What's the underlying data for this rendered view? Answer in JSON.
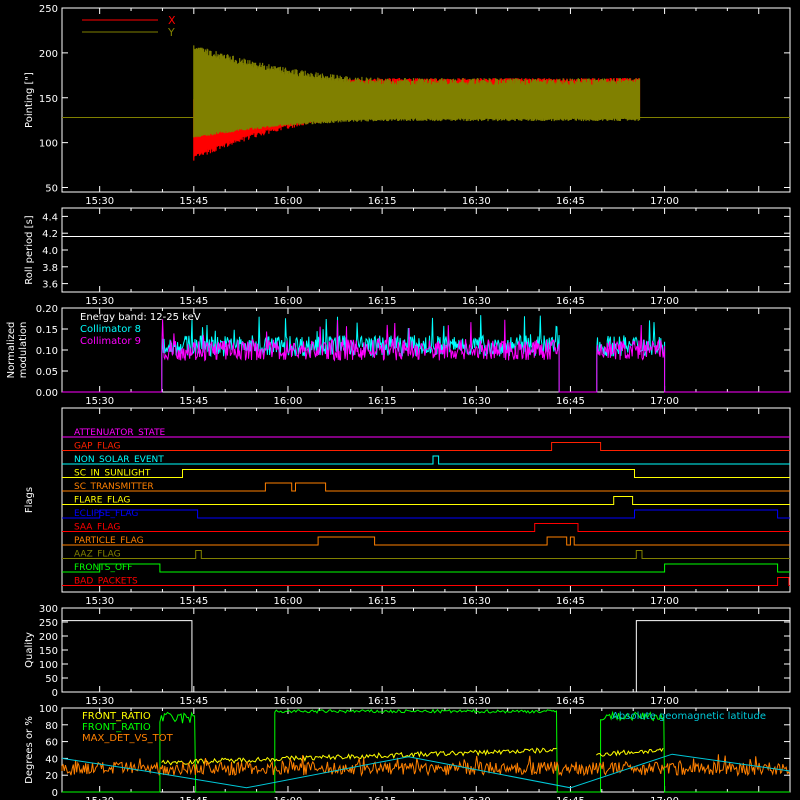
{
  "chart_data": [
    {
      "type": "line",
      "panel": "pointing",
      "ylabel": "Pointing [\"]",
      "ylim": [
        45,
        250
      ],
      "yticks": [
        "50",
        "100",
        "150",
        "200",
        "250"
      ],
      "x_ticks": [
        "15:30",
        "15:45",
        "16:00",
        "16:15",
        "16:30",
        "16:45",
        "17:00"
      ],
      "flat_value": 128,
      "oscillation_start": "15:45",
      "oscillation_end": "16:56",
      "series": [
        {
          "name": "X",
          "color": "#ff0000",
          "envelope_low_start": 80,
          "envelope_low_end": 130,
          "envelope_high_start": 152,
          "envelope_high_end": 172
        },
        {
          "name": "Y",
          "color": "#808000",
          "envelope_low_start": 105,
          "envelope_low_end": 124,
          "envelope_high_start": 210,
          "envelope_high_end": 172
        }
      ]
    },
    {
      "type": "line",
      "panel": "roll",
      "ylabel": "Roll period [s]",
      "ylim": [
        3.5,
        4.5
      ],
      "yticks": [
        "3.6",
        "3.8",
        "4.0",
        "4.2",
        "4.4"
      ],
      "x_ticks": [
        "15:30",
        "15:45",
        "16:00",
        "16:15",
        "16:30",
        "16:45",
        "17:00"
      ],
      "series": [
        {
          "name": "",
          "color": "#ffffff",
          "value": 4.16
        }
      ]
    },
    {
      "type": "line",
      "panel": "modulation",
      "ylabel": "Normalized modulation",
      "ylim": [
        0,
        0.2
      ],
      "yticks": [
        "0.00",
        "0.05",
        "0.10",
        "0.15",
        "0.20"
      ],
      "x_ticks": [
        "15:30",
        "15:45",
        "16:00",
        "16:15",
        "16:30",
        "16:45",
        "17:00"
      ],
      "annotation": "Energy band: 12-25 keV",
      "series": [
        {
          "name": "Collimator 8",
          "color": "#00ffff",
          "mean": 0.11
        },
        {
          "name": "Collimator 9",
          "color": "#ff00ff",
          "mean": 0.1
        }
      ]
    },
    {
      "type": "line",
      "panel": "flags",
      "ylabel": "Flags",
      "x_ticks": [
        "15:30",
        "15:45",
        "16:00",
        "16:15",
        "16:30",
        "16:45",
        "17:00"
      ],
      "series": [
        {
          "name": "ATTENUATOR_STATE",
          "color": "#ff00ff",
          "segments": []
        },
        {
          "name": "GAP_FLAG",
          "color": "#ff2000",
          "segments": [
            [
              16.7,
              16.83
            ]
          ]
        },
        {
          "name": "NON_SOLAR_EVENT",
          "color": "#00ffff",
          "segments": [
            [
              16.385,
              16.4
            ]
          ]
        },
        {
          "name": "SC_IN_SUNLIGHT",
          "color": "#ffff00",
          "segments": [
            [
              15.72,
              16.92
            ]
          ]
        },
        {
          "name": "SC_TRANSMITTER",
          "color": "#ff8000",
          "segments": [
            [
              15.94,
              16.01
            ],
            [
              16.02,
              16.1
            ]
          ]
        },
        {
          "name": "FLARE_FLAG",
          "color": "#ffff00",
          "segments": [
            [
              16.865,
              16.915
            ]
          ]
        },
        {
          "name": "ECLIPSE_FLAG",
          "color": "#0000ff",
          "segments": [
            [
              15.5,
              15.76
            ],
            [
              16.92,
              17.3
            ]
          ]
        },
        {
          "name": "SAA_FLAG",
          "color": "#ff0000",
          "segments": [
            [
              16.655,
              16.77
            ]
          ]
        },
        {
          "name": "PARTICLE_FLAG",
          "color": "#ff8000",
          "segments": [
            [
              16.08,
              16.23
            ],
            [
              16.688,
              16.74
            ],
            [
              16.75,
              16.76
            ]
          ]
        },
        {
          "name": "AAZ_FLAG",
          "color": "#808000",
          "segments": [
            [
              15.755,
              15.77
            ],
            [
              16.925,
              16.94
            ]
          ]
        },
        {
          "name": "FRONTS_OFF",
          "color": "#00ff00",
          "segments": [
            [
              15.5,
              15.66
            ],
            [
              17.0,
              17.3
            ]
          ]
        },
        {
          "name": "BAD_PACKETS",
          "color": "#ff0000",
          "segments": [
            [
              17.3,
              17.33
            ]
          ]
        }
      ]
    },
    {
      "type": "line",
      "panel": "quality",
      "ylabel": "Quality",
      "ylim": [
        0,
        300
      ],
      "yticks": [
        "0",
        "50",
        "100",
        "150",
        "200",
        "250",
        "300"
      ],
      "x_ticks": [
        "15:30",
        "15:45",
        "16:00",
        "16:15",
        "16:30",
        "16:45",
        "17:00"
      ],
      "series": [
        {
          "name": "",
          "color": "#ffffff",
          "high": 255
        }
      ]
    },
    {
      "type": "line",
      "panel": "ratios",
      "ylabel": "Degrees or %",
      "ylim": [
        0,
        100
      ],
      "yticks": [
        "0",
        "20",
        "40",
        "60",
        "80",
        "100"
      ],
      "x_ticks": [
        "15:30",
        "15:45",
        "16:00",
        "16:15",
        "16:30",
        "16:45",
        "17:00"
      ],
      "series": [
        {
          "name": "FRONT_RATIO",
          "color": "#ffff00"
        },
        {
          "name": "FRONT_RATIO",
          "color": "#00ff00"
        },
        {
          "name": "MAX_DET_VS_TOT",
          "color": "#ff8000"
        },
        {
          "name": "Absolute geomagnetic latitude",
          "color": "#00c8d8"
        }
      ]
    }
  ]
}
